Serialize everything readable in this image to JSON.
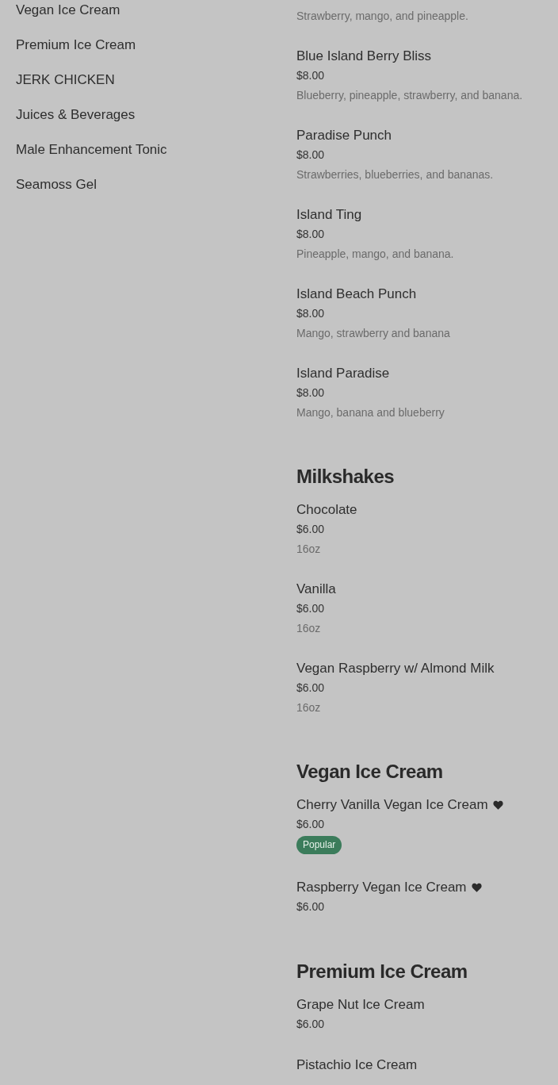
{
  "sidebar": {
    "items": [
      {
        "label": "Vegan Ice Cream"
      },
      {
        "label": "Premium Ice Cream"
      },
      {
        "label": "JERK CHICKEN"
      },
      {
        "label": "Juices & Beverages"
      },
      {
        "label": "Male Enhancement Tonic"
      },
      {
        "label": "Seamoss Gel"
      }
    ]
  },
  "menu": {
    "sections": [
      {
        "items": [
          {
            "description": "Strawberry, mango, and pineapple."
          },
          {
            "name": "Blue Island Berry Bliss",
            "price": "$8.00",
            "description": "Blueberry, pineapple, strawberry, and banana."
          },
          {
            "name": "Paradise Punch",
            "price": "$8.00",
            "description": "Strawberries, blueberries, and bananas."
          },
          {
            "name": "Island Ting",
            "price": "$8.00",
            "description": "Pineapple, mango, and banana."
          },
          {
            "name": "Island Beach Punch",
            "price": "$8.00",
            "description": "Mango, strawberry and banana"
          },
          {
            "name": "Island Paradise",
            "price": "$8.00",
            "description": "Mango, banana and blueberry"
          }
        ]
      },
      {
        "title": "Milkshakes",
        "items": [
          {
            "name": "Chocolate",
            "price": "$6.00",
            "description": "16oz"
          },
          {
            "name": "Vanilla",
            "price": "$6.00",
            "description": "16oz"
          },
          {
            "name": "Vegan Raspberry w/ Almond Milk",
            "price": "$6.00",
            "description": "16oz"
          }
        ]
      },
      {
        "title": "Vegan Ice Cream",
        "items": [
          {
            "name": "Cherry Vanilla Vegan Ice Cream",
            "heart": true,
            "price": "$6.00",
            "badge": "Popular"
          },
          {
            "name": "Raspberry Vegan Ice Cream",
            "heart": true,
            "price": "$6.00"
          }
        ]
      },
      {
        "title": "Premium Ice Cream",
        "items": [
          {
            "name": "Grape Nut Ice Cream",
            "price": "$6.00"
          },
          {
            "name": "Pistachio Ice Cream"
          }
        ]
      }
    ]
  }
}
